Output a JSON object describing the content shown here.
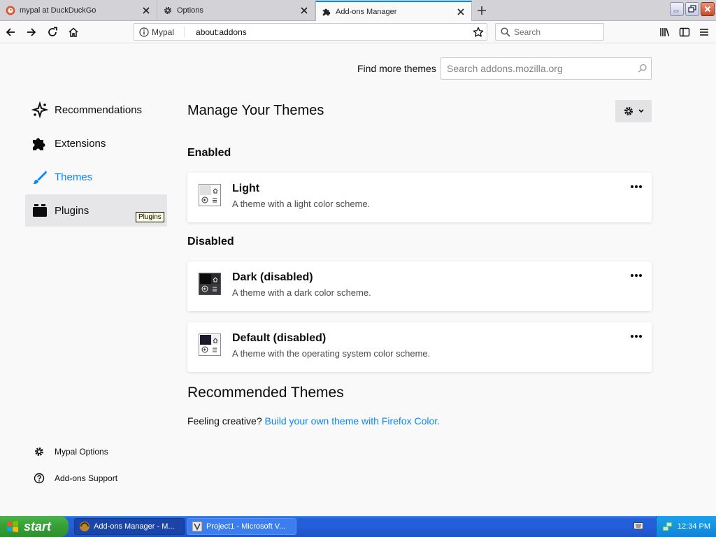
{
  "tabs": [
    {
      "label": "mypal at DuckDuckGo",
      "icon": "duckduckgo-icon",
      "active": false
    },
    {
      "label": "Options",
      "icon": "gear-icon",
      "active": false
    },
    {
      "label": "Add-ons Manager",
      "icon": "puzzle-icon",
      "active": true
    }
  ],
  "nav": {
    "identity_label": "Mypal",
    "url": "about:addons",
    "search_placeholder": "Search"
  },
  "addons": {
    "find_more_label": "Find more themes",
    "amo_search_placeholder": "Search addons.mozilla.org",
    "categories": [
      {
        "label": "Recommendations",
        "icon": "recommendations-icon"
      },
      {
        "label": "Extensions",
        "icon": "puzzle-icon"
      },
      {
        "label": "Themes",
        "icon": "brush-icon",
        "selected": true
      },
      {
        "label": "Plugins",
        "icon": "plugin-icon",
        "hover": true
      }
    ],
    "tooltip": "Plugins",
    "footer_links": [
      {
        "label": "Mypal Options",
        "icon": "gear-icon"
      },
      {
        "label": "Add-ons Support",
        "icon": "help-icon"
      }
    ],
    "heading": "Manage Your Themes",
    "enabled_heading": "Enabled",
    "disabled_heading": "Disabled",
    "themes": [
      {
        "name": "Light",
        "description": "A theme with a light color scheme.",
        "swatch": "#e9e9ea",
        "status": "enabled"
      },
      {
        "name": "Dark (disabled)",
        "description": "A theme with a dark color scheme.",
        "swatch": "#0c0c0d",
        "status": "disabled"
      },
      {
        "name": "Default (disabled)",
        "description": "A theme with the operating system color scheme.",
        "swatch": "#1c1b2e",
        "status": "disabled"
      }
    ],
    "recommended_heading": "Recommended Themes",
    "recommended_text": "Feeling creative?",
    "recommended_link": "Build your own theme with Firefox Color."
  },
  "taskbar": {
    "start_label": "start",
    "tasks": [
      {
        "label": "Add-ons Manager - M...",
        "active": true
      },
      {
        "label": "Project1 - Microsoft V...",
        "active": false
      }
    ],
    "clock": "12:34 PM"
  },
  "colors": {
    "accent": "#0a84ff",
    "page_background": "#f9f9fa",
    "taskbar_blue": "#245edb",
    "start_green": "#37a337"
  }
}
